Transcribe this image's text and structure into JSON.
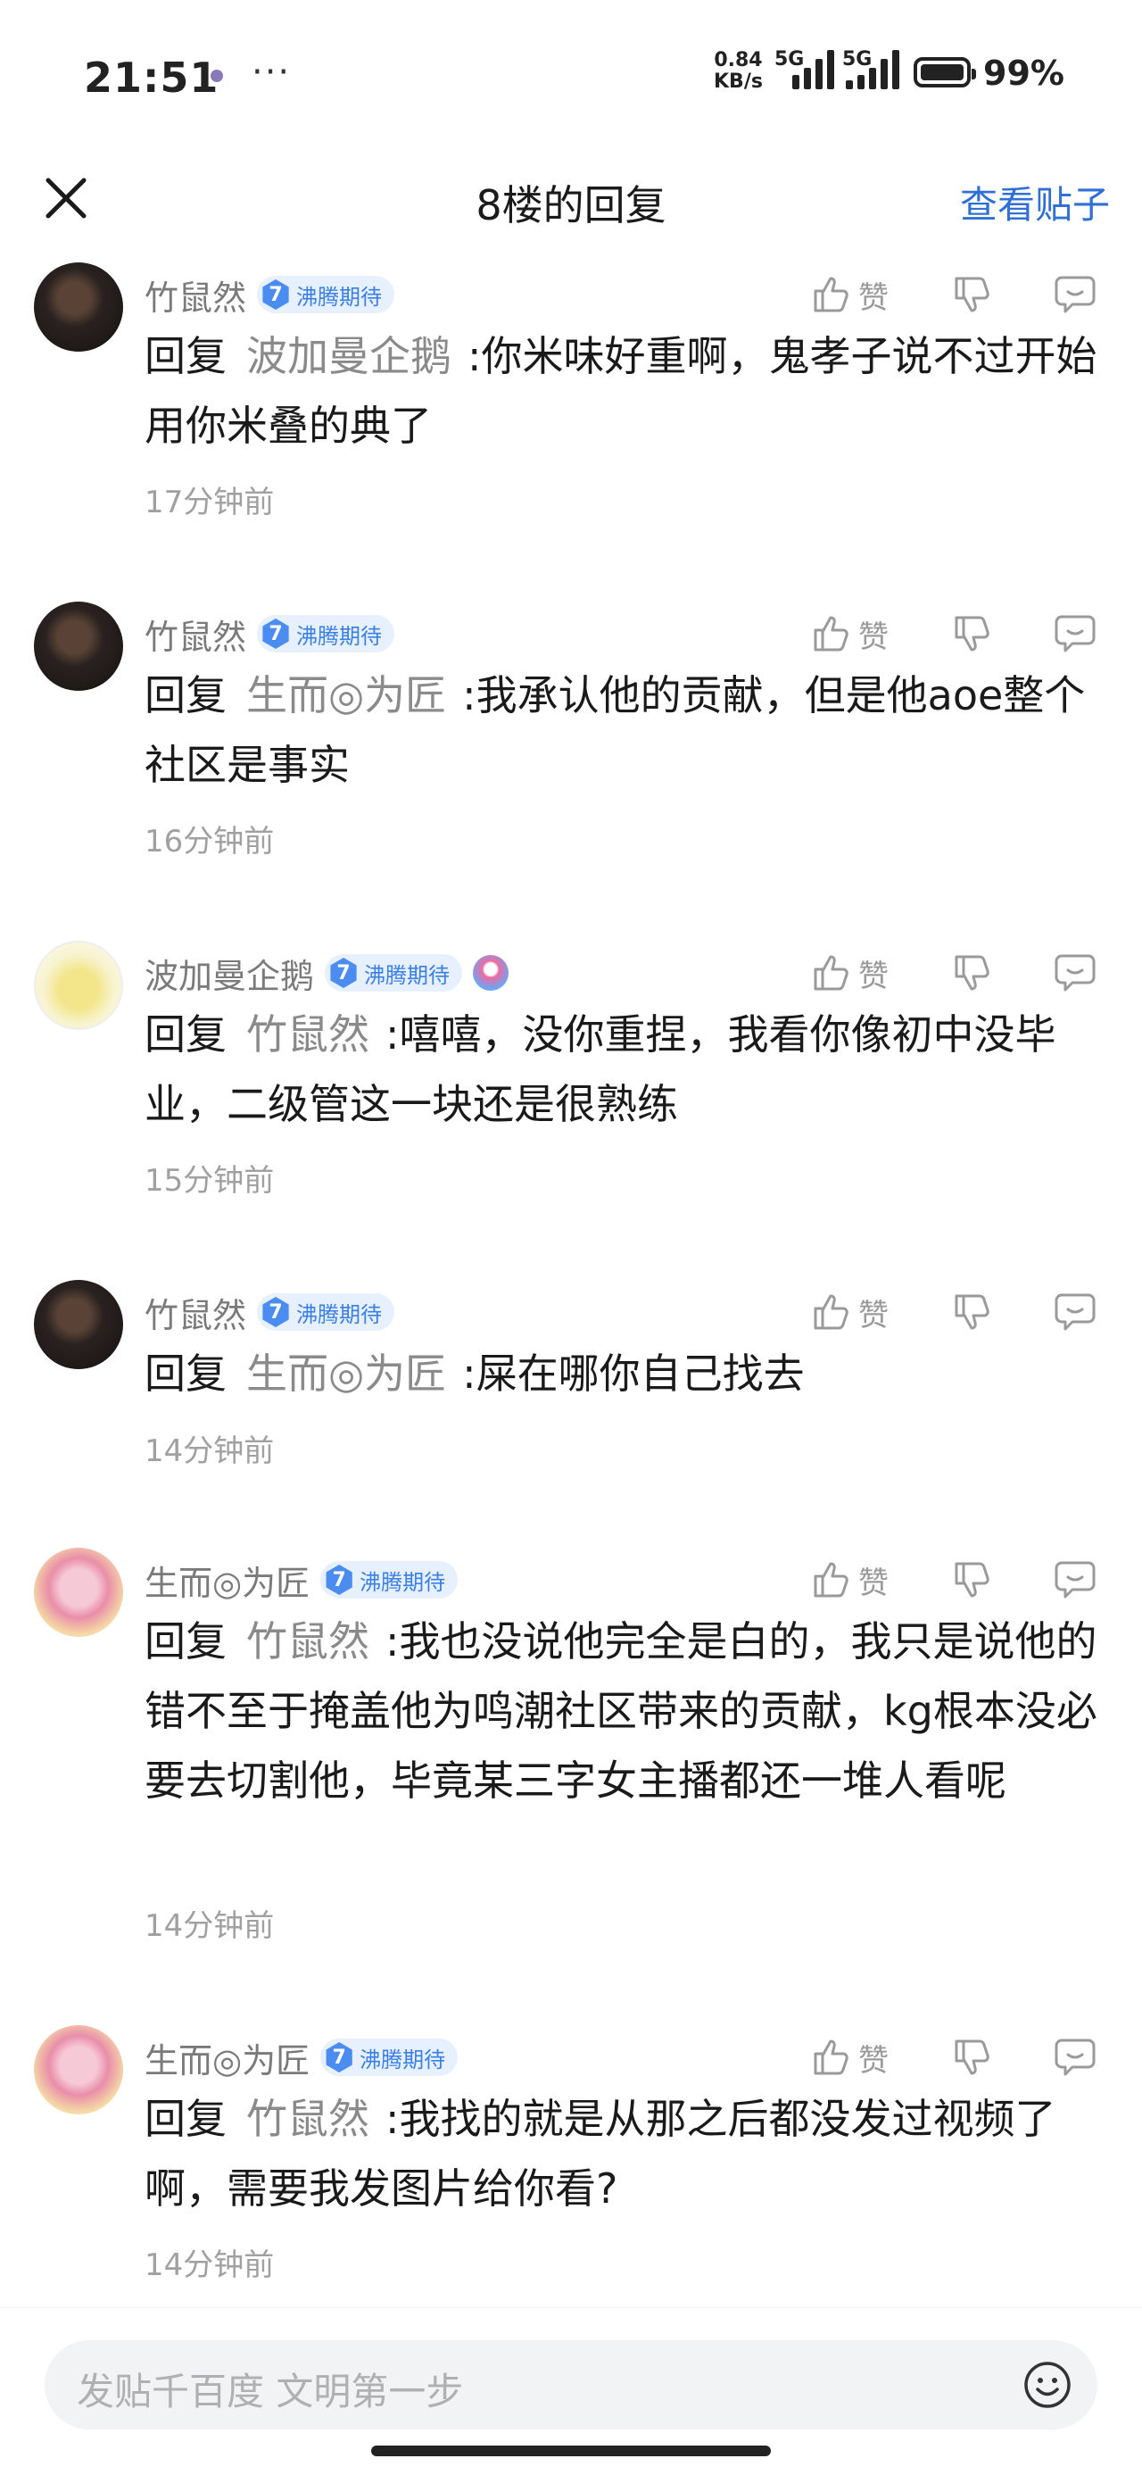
{
  "status_bar": {
    "time": "21:51",
    "more": "···",
    "speed_value": "0.84",
    "speed_unit": "KB/s",
    "net1": "5G",
    "net2": "5G",
    "battery": "99%"
  },
  "header": {
    "title": "8楼的回复",
    "view_post": "查看贴子"
  },
  "reply_prefix": "回复",
  "like_label": "赞",
  "replies": [
    {
      "user": "竹鼠然",
      "level": "7",
      "badge": "沸腾期待",
      "to": "波加曼企鹅",
      "text": ":你米味好重啊，鬼孝子说不过开始用你米叠的典了",
      "time": "17分钟前"
    },
    {
      "user": "竹鼠然",
      "level": "7",
      "badge": "沸腾期待",
      "to": "生而◎为匠",
      "text": ":我承认他的贡献，但是他aoe整个社区是事实",
      "time": "16分钟前"
    },
    {
      "user": "波加曼企鹅",
      "level": "7",
      "badge": "沸腾期待",
      "to": "竹鼠然",
      "text": ":嘻嘻，没你重捏，我看你像初中没毕业，二级管这一块还是很熟练",
      "time": "15分钟前"
    },
    {
      "user": "竹鼠然",
      "level": "7",
      "badge": "沸腾期待",
      "to": "生而◎为匠",
      "text": ":屎在哪你自己找去",
      "time": "14分钟前"
    },
    {
      "user": "生而◎为匠",
      "level": "7",
      "badge": "沸腾期待",
      "to": "竹鼠然",
      "text": ":我也没说他完全是白的，我只是说他的错不至于掩盖他为鸣潮社区带来的贡献，kg根本没必要去切割他，毕竟某三字女主播都还一堆人看呢",
      "time": "14分钟前"
    },
    {
      "user": "生而◎为匠",
      "level": "7",
      "badge": "沸腾期待",
      "to": "竹鼠然",
      "text": ":我找的就是从那之后都没发过视频了啊，需要我发图片给你看?",
      "time": "14分钟前"
    }
  ],
  "composer": {
    "placeholder": "发贴千百度 文明第一步"
  },
  "icons": {
    "close": "close-icon",
    "like": "thumbs-up-icon",
    "dislike": "thumbs-down-icon",
    "comment": "comment-icon",
    "emoji": "emoji-icon"
  }
}
